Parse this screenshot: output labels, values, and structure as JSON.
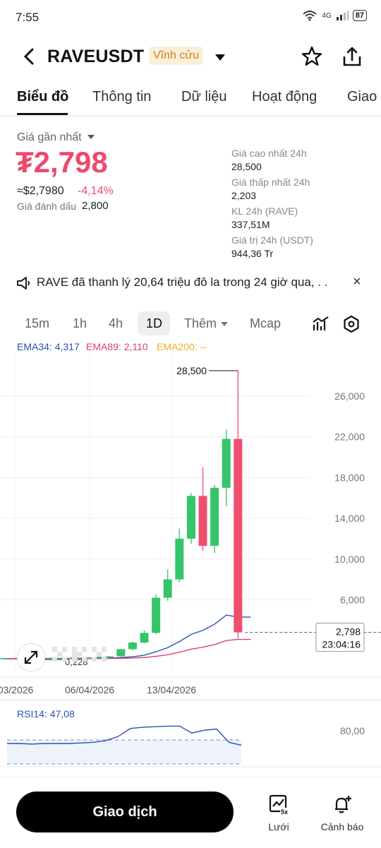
{
  "status": {
    "time": "7:55",
    "network": "4G",
    "battery": "87"
  },
  "header": {
    "pair": "RAVEUSDT",
    "badge": "Vĩnh cửu"
  },
  "tabs": [
    "Biểu đồ",
    "Thông tin",
    "Dữ liệu",
    "Hoạt động",
    "Giao"
  ],
  "summary": {
    "last_label": "Giá gần nhất",
    "price": "₮2,798",
    "usd": "≈$2,7980",
    "change": "-4,14%",
    "mark_label": "Giá đánh dấu",
    "mark_value": "2,800"
  },
  "stats": [
    {
      "label": "Giá cao nhất 24h",
      "value": "28,500"
    },
    {
      "label": "Giá thấp nhất 24h",
      "value": "2,203"
    },
    {
      "label": "KL 24h (RAVE)",
      "value": "337,51M"
    },
    {
      "label": "Giá trị 24h (USDT)",
      "value": "944,36 Tr"
    }
  ],
  "notice": {
    "text": "RAVE đã thanh lý 20,64 triệu đô la trong 24 giờ qua, . .",
    "close": "×"
  },
  "timeframes": [
    "15m",
    "1h",
    "4h",
    "1D",
    "Thêm",
    "Mcap"
  ],
  "indicators": {
    "ema34": "EMA34: 4,317",
    "ema89": "EMA89: 2,110",
    "ema200": "EMA200: --",
    "colors": {
      "ema34": "#2a4fb0",
      "ema89": "#d9417a",
      "ema200": "#e8b12c"
    }
  },
  "colors": {
    "up": "#35c46a",
    "down": "#ee4f6e"
  },
  "chart_data": {
    "type": "candlestick",
    "y_ticks": [
      "26,000",
      "22,000",
      "18,000",
      "14,000",
      "10,000",
      "6,000"
    ],
    "x_ticks": [
      "03/2026",
      "06/04/2026",
      "13/04/2026"
    ],
    "high_label": "28,500",
    "low_label": "0,228",
    "last_price_label": "2,798",
    "countdown": "23:04:16",
    "candles": [
      {
        "o": 0.23,
        "h": 0.3,
        "l": 0.2,
        "c": 0.26
      },
      {
        "o": 0.26,
        "h": 0.33,
        "l": 0.22,
        "c": 0.24
      },
      {
        "o": 0.24,
        "h": 0.3,
        "l": 0.21,
        "c": 0.27
      },
      {
        "o": 0.27,
        "h": 0.34,
        "l": 0.23,
        "c": 0.25
      },
      {
        "o": 0.25,
        "h": 0.32,
        "l": 0.22,
        "c": 0.29
      },
      {
        "o": 0.29,
        "h": 0.36,
        "l": 0.25,
        "c": 0.3
      },
      {
        "o": 0.3,
        "h": 0.38,
        "l": 0.27,
        "c": 0.33
      },
      {
        "o": 0.33,
        "h": 0.42,
        "l": 0.3,
        "c": 0.36
      },
      {
        "o": 0.36,
        "h": 0.45,
        "l": 0.32,
        "c": 0.4
      },
      {
        "o": 0.4,
        "h": 0.48,
        "l": 0.36,
        "c": 0.45
      },
      {
        "o": 0.45,
        "h": 1.2,
        "l": 0.42,
        "c": 1.15
      },
      {
        "o": 1.15,
        "h": 1.9,
        "l": 1.0,
        "c": 1.8
      },
      {
        "o": 1.8,
        "h": 3.0,
        "l": 1.7,
        "c": 2.75
      },
      {
        "o": 2.75,
        "h": 6.5,
        "l": 2.6,
        "c": 6.2
      },
      {
        "o": 6.2,
        "h": 9.0,
        "l": 5.9,
        "c": 8.0
      },
      {
        "o": 8.0,
        "h": 13.0,
        "l": 7.7,
        "c": 12.0
      },
      {
        "o": 12.0,
        "h": 16.5,
        "l": 11.5,
        "c": 16.2
      },
      {
        "o": 16.2,
        "h": 19.0,
        "l": 10.8,
        "c": 11.3
      },
      {
        "o": 11.3,
        "h": 17.3,
        "l": 10.6,
        "c": 17.0
      },
      {
        "o": 17.0,
        "h": 22.7,
        "l": 15.2,
        "c": 21.8
      },
      {
        "o": 21.8,
        "h": 28.5,
        "l": 2.2,
        "c": 2.8
      }
    ],
    "ema34": [
      0.22,
      0.22,
      0.23,
      0.23,
      0.24,
      0.24,
      0.25,
      0.26,
      0.27,
      0.28,
      0.32,
      0.4,
      0.55,
      0.9,
      1.3,
      1.9,
      2.6,
      3.0,
      3.6,
      4.5,
      4.3
    ],
    "ema89": [
      0.2,
      0.2,
      0.21,
      0.21,
      0.21,
      0.22,
      0.22,
      0.23,
      0.23,
      0.24,
      0.25,
      0.28,
      0.33,
      0.45,
      0.6,
      0.85,
      1.15,
      1.35,
      1.6,
      2.0,
      2.11
    ],
    "rsi": {
      "label": "RSI14: 47,08",
      "tick": "80,00",
      "values": [
        50,
        50,
        49,
        50,
        50,
        50,
        51,
        52,
        55,
        62,
        76,
        78,
        79,
        80,
        80,
        68,
        73,
        75,
        52,
        47
      ]
    }
  },
  "bottom": {
    "trade": "Giao dịch",
    "grid": "Lưới",
    "grid_badge": "5x",
    "alert": "Cảnh báo"
  }
}
